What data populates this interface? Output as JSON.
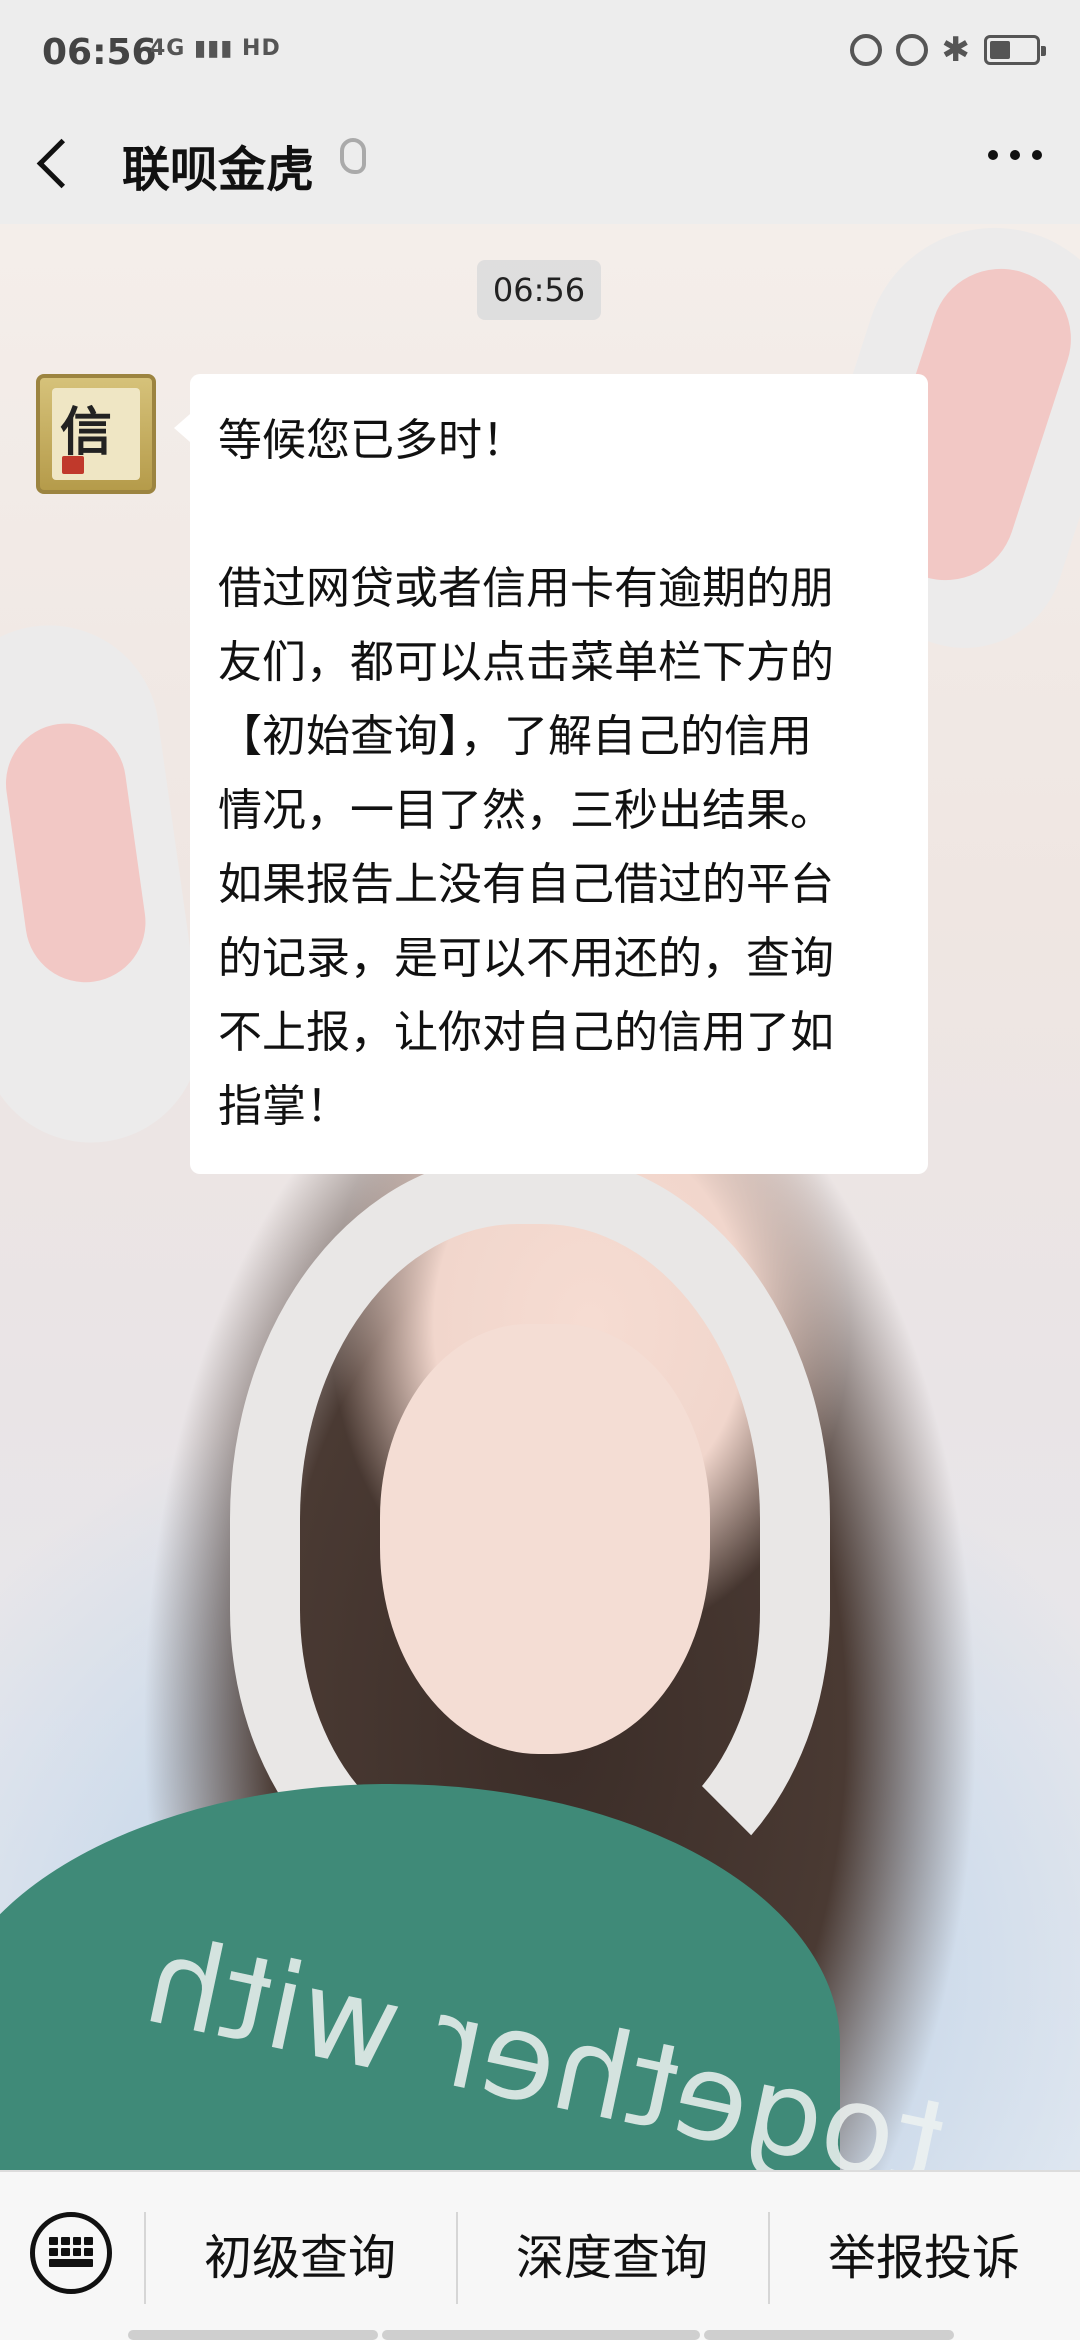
{
  "status_bar": {
    "time": "06:56",
    "network": "4G",
    "network_hd": "HD"
  },
  "header": {
    "title": "联呗金虎"
  },
  "chat": {
    "timestamp": "06:56",
    "avatar_char": "信",
    "message_lines": [
      "等候您已多时！",
      "",
      "借过网贷或者信用卡有逾期的朋",
      "友们，都可以点击菜单栏下方的",
      "【初始查询】，了解自己的信用",
      "情况，一目了然，三秒出结果。",
      "如果报告上没有自己借过的平台",
      "的记录，是可以不用还的，查询",
      "不上报，让你对自己的信用了如",
      "指掌！"
    ],
    "background_text": "together with"
  },
  "menu": {
    "items": [
      "初级查询",
      "深度查询",
      "举报投诉"
    ]
  }
}
